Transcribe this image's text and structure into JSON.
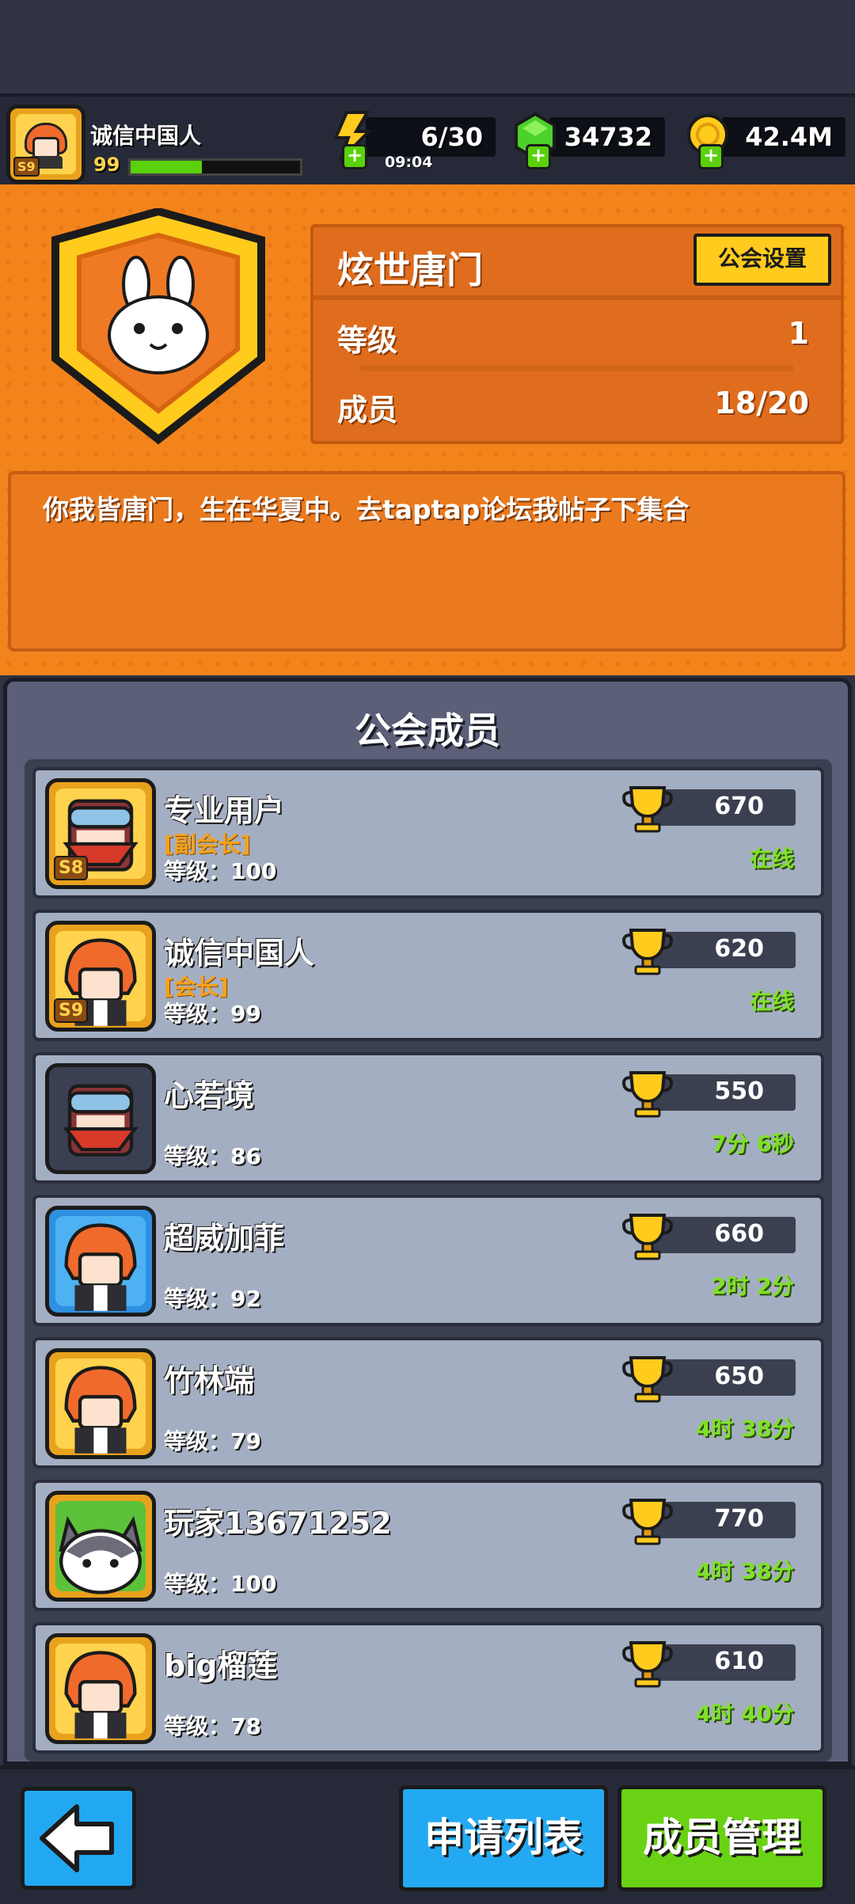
{
  "player": {
    "name": "诚信中国人",
    "level": "99",
    "season_badge": "S9",
    "xp_progress": 0.42
  },
  "resources": {
    "energy": "6/30",
    "energy_timer": "09:04",
    "gems": "34732",
    "coins": "42.4M"
  },
  "guild": {
    "name": "炫世唐门",
    "settings_label": "公会设置",
    "level_label": "等级",
    "level_value": "1",
    "members_label": "成员",
    "members_value": "18/20",
    "motto": "你我皆唐门，生在华夏中。去taptap论坛我帖子下集合"
  },
  "members_title": "公会成员",
  "members": [
    {
      "name": "专业用户",
      "role": "[副会长]",
      "level": "等级：100",
      "trophies": "670",
      "status": "在线",
      "badge": "S8",
      "avatar": "masked"
    },
    {
      "name": "诚信中国人",
      "role": "[会长]",
      "level": "等级：99",
      "trophies": "620",
      "status": "在线",
      "badge": "S9",
      "avatar": "redhair"
    },
    {
      "name": "心若境",
      "role": "",
      "level": "等级：86",
      "trophies": "550",
      "status": "7分 6秒",
      "badge": "",
      "avatar": "masked-plain"
    },
    {
      "name": "超威加菲",
      "role": "",
      "level": "等级：92",
      "trophies": "660",
      "status": "2时 2分",
      "badge": "",
      "avatar": "redhair-blue"
    },
    {
      "name": "竹林端",
      "role": "",
      "level": "等级：79",
      "trophies": "650",
      "status": "4时 38分",
      "badge": "",
      "avatar": "redhair"
    },
    {
      "name": "玩家13671252",
      "role": "",
      "level": "等级：100",
      "trophies": "770",
      "status": "4时 38分",
      "badge": "",
      "avatar": "cat"
    },
    {
      "name": "big榴莲",
      "role": "",
      "level": "等级：78",
      "trophies": "610",
      "status": "4时 40分",
      "badge": "",
      "avatar": "redhair"
    }
  ],
  "bottom": {
    "back_icon": "arrow-left-icon",
    "apply_list": "申请列表",
    "member_manage": "成员管理"
  },
  "colors": {
    "accent_orange": "#f3841c",
    "online_green": "#7fe02a",
    "button_blue": "#23a9f1",
    "button_green": "#6ad215"
  }
}
